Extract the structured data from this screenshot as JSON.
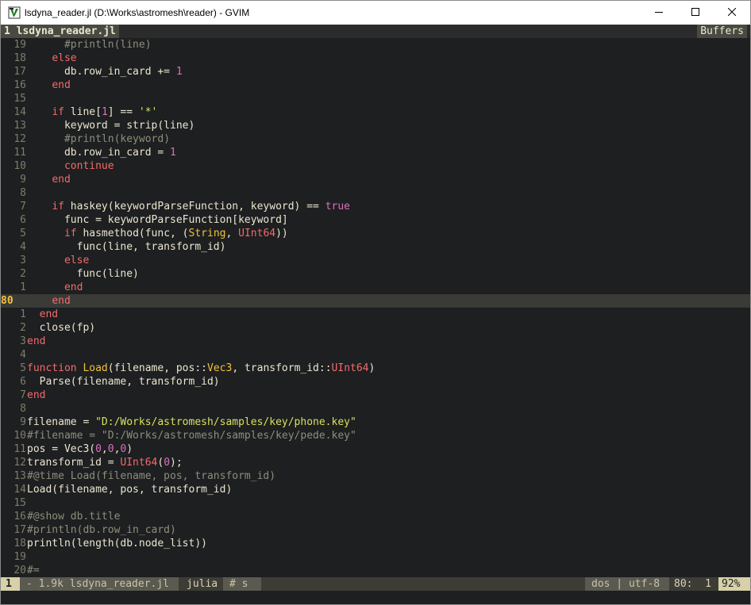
{
  "window": {
    "title": "lsdyna_reader.jl (D:\\Works\\astromesh\\reader) - GVIM",
    "icon": "gvim-icon",
    "controls": {
      "minimize": "minimize-icon",
      "maximize": "maximize-icon",
      "close": "close-icon"
    }
  },
  "tabline": {
    "active_tab": "1 lsdyna_reader.jl",
    "buffers_label": "Buffers"
  },
  "colors": {
    "background": "#1d1f21",
    "keyword": "#f46a6a",
    "function": "#f3c13c",
    "number": "#dd6fbf",
    "string": "#d7e05e",
    "comment": "#8e8e7c",
    "cursor_line_number": "#f3c13c"
  },
  "editor": {
    "cursor_line_number": "80",
    "lines": [
      {
        "n": "19",
        "tokens": [
          [
            "txt",
            "      "
          ],
          [
            "cmt",
            "#println(line)"
          ]
        ]
      },
      {
        "n": "18",
        "tokens": [
          [
            "txt",
            "    "
          ],
          [
            "kw",
            "else"
          ]
        ]
      },
      {
        "n": "17",
        "tokens": [
          [
            "txt",
            "      db.row_in_card += "
          ],
          [
            "num",
            "1"
          ]
        ]
      },
      {
        "n": "16",
        "tokens": [
          [
            "txt",
            "    "
          ],
          [
            "kw",
            "end"
          ]
        ]
      },
      {
        "n": "15",
        "tokens": []
      },
      {
        "n": "14",
        "tokens": [
          [
            "txt",
            "    "
          ],
          [
            "kw",
            "if"
          ],
          [
            "txt",
            " line["
          ],
          [
            "num",
            "1"
          ],
          [
            "txt",
            "] == "
          ],
          [
            "str",
            "'*'"
          ]
        ]
      },
      {
        "n": "13",
        "tokens": [
          [
            "txt",
            "      keyword = strip(line)"
          ]
        ]
      },
      {
        "n": "12",
        "tokens": [
          [
            "txt",
            "      "
          ],
          [
            "cmt",
            "#println(keyword)"
          ]
        ]
      },
      {
        "n": "11",
        "tokens": [
          [
            "txt",
            "      db.row_in_card = "
          ],
          [
            "num",
            "1"
          ]
        ]
      },
      {
        "n": "10",
        "tokens": [
          [
            "txt",
            "      "
          ],
          [
            "kw",
            "continue"
          ]
        ]
      },
      {
        "n": "9",
        "tokens": [
          [
            "txt",
            "    "
          ],
          [
            "kw",
            "end"
          ]
        ]
      },
      {
        "n": "8",
        "tokens": []
      },
      {
        "n": "7",
        "tokens": [
          [
            "txt",
            "    "
          ],
          [
            "kw",
            "if"
          ],
          [
            "txt",
            " haskey(keywordParseFunction, keyword) == "
          ],
          [
            "num",
            "true"
          ]
        ]
      },
      {
        "n": "6",
        "tokens": [
          [
            "txt",
            "      func = keywordParseFunction[keyword]"
          ]
        ]
      },
      {
        "n": "5",
        "tokens": [
          [
            "txt",
            "      "
          ],
          [
            "kw",
            "if"
          ],
          [
            "txt",
            " hasmethod(func, ("
          ],
          [
            "type",
            "String"
          ],
          [
            "txt",
            ", "
          ],
          [
            "kw",
            "UInt64"
          ],
          [
            "txt",
            "))"
          ]
        ]
      },
      {
        "n": "4",
        "tokens": [
          [
            "txt",
            "        func(line, transform_id)"
          ]
        ]
      },
      {
        "n": "3",
        "tokens": [
          [
            "txt",
            "      "
          ],
          [
            "kw",
            "else"
          ]
        ]
      },
      {
        "n": "2",
        "tokens": [
          [
            "txt",
            "        func(line)"
          ]
        ]
      },
      {
        "n": "1",
        "tokens": [
          [
            "txt",
            "      "
          ],
          [
            "kw",
            "end"
          ]
        ]
      },
      {
        "n": "80",
        "current": true,
        "tokens": [
          [
            "txt",
            "    "
          ],
          [
            "kw",
            "end"
          ]
        ]
      },
      {
        "n": "1",
        "tokens": [
          [
            "txt",
            "  "
          ],
          [
            "kw",
            "end"
          ]
        ]
      },
      {
        "n": "2",
        "tokens": [
          [
            "txt",
            "  close(fp)"
          ]
        ]
      },
      {
        "n": "3",
        "tokens": [
          [
            "kw",
            "end"
          ]
        ]
      },
      {
        "n": "4",
        "tokens": []
      },
      {
        "n": "5",
        "tokens": [
          [
            "kw",
            "function"
          ],
          [
            "txt",
            " "
          ],
          [
            "fn",
            "Load"
          ],
          [
            "txt",
            "(filename, pos::"
          ],
          [
            "type",
            "Vec3"
          ],
          [
            "txt",
            ", transform_id::"
          ],
          [
            "kw",
            "UInt64"
          ],
          [
            "txt",
            ")"
          ]
        ]
      },
      {
        "n": "6",
        "tokens": [
          [
            "txt",
            "  Parse(filename, transform_id)"
          ]
        ]
      },
      {
        "n": "7",
        "tokens": [
          [
            "kw",
            "end"
          ]
        ]
      },
      {
        "n": "8",
        "tokens": []
      },
      {
        "n": "9",
        "tokens": [
          [
            "txt",
            "filename = "
          ],
          [
            "str",
            "\"D:/Works/astromesh/samples/key/phone.key\""
          ]
        ]
      },
      {
        "n": "10",
        "tokens": [
          [
            "cmt",
            "#filename = \"D:/Works/astromesh/samples/key/pede.key\""
          ]
        ]
      },
      {
        "n": "11",
        "tokens": [
          [
            "txt",
            "pos = Vec3("
          ],
          [
            "num",
            "0"
          ],
          [
            "txt",
            ","
          ],
          [
            "num",
            "0"
          ],
          [
            "txt",
            ","
          ],
          [
            "num",
            "0"
          ],
          [
            "txt",
            ")"
          ]
        ]
      },
      {
        "n": "12",
        "tokens": [
          [
            "txt",
            "transform_id = "
          ],
          [
            "kw",
            "UInt64"
          ],
          [
            "txt",
            "("
          ],
          [
            "num",
            "0"
          ],
          [
            "txt",
            ");"
          ]
        ]
      },
      {
        "n": "13",
        "tokens": [
          [
            "cmt",
            "#@time Load(filename, pos, transform_id)"
          ]
        ]
      },
      {
        "n": "14",
        "tokens": [
          [
            "txt",
            "Load(filename, pos, transform_id)"
          ]
        ]
      },
      {
        "n": "15",
        "tokens": []
      },
      {
        "n": "16",
        "tokens": [
          [
            "cmt",
            "#@show db.title"
          ]
        ]
      },
      {
        "n": "17",
        "tokens": [
          [
            "cmt",
            "#println(db.row_in_card)"
          ]
        ]
      },
      {
        "n": "18",
        "tokens": [
          [
            "txt",
            "println(length(db.node_list))"
          ]
        ]
      },
      {
        "n": "19",
        "tokens": []
      },
      {
        "n": "20",
        "tokens": [
          [
            "cmt",
            "#="
          ]
        ]
      }
    ]
  },
  "statusline": {
    "mode": "1",
    "file_info": "- 1.9k lsdyna_reader.jl",
    "filetype": "julia",
    "tag": "# s",
    "encoding": "dos | utf-8",
    "position": "80:  1",
    "percent": "92%"
  }
}
